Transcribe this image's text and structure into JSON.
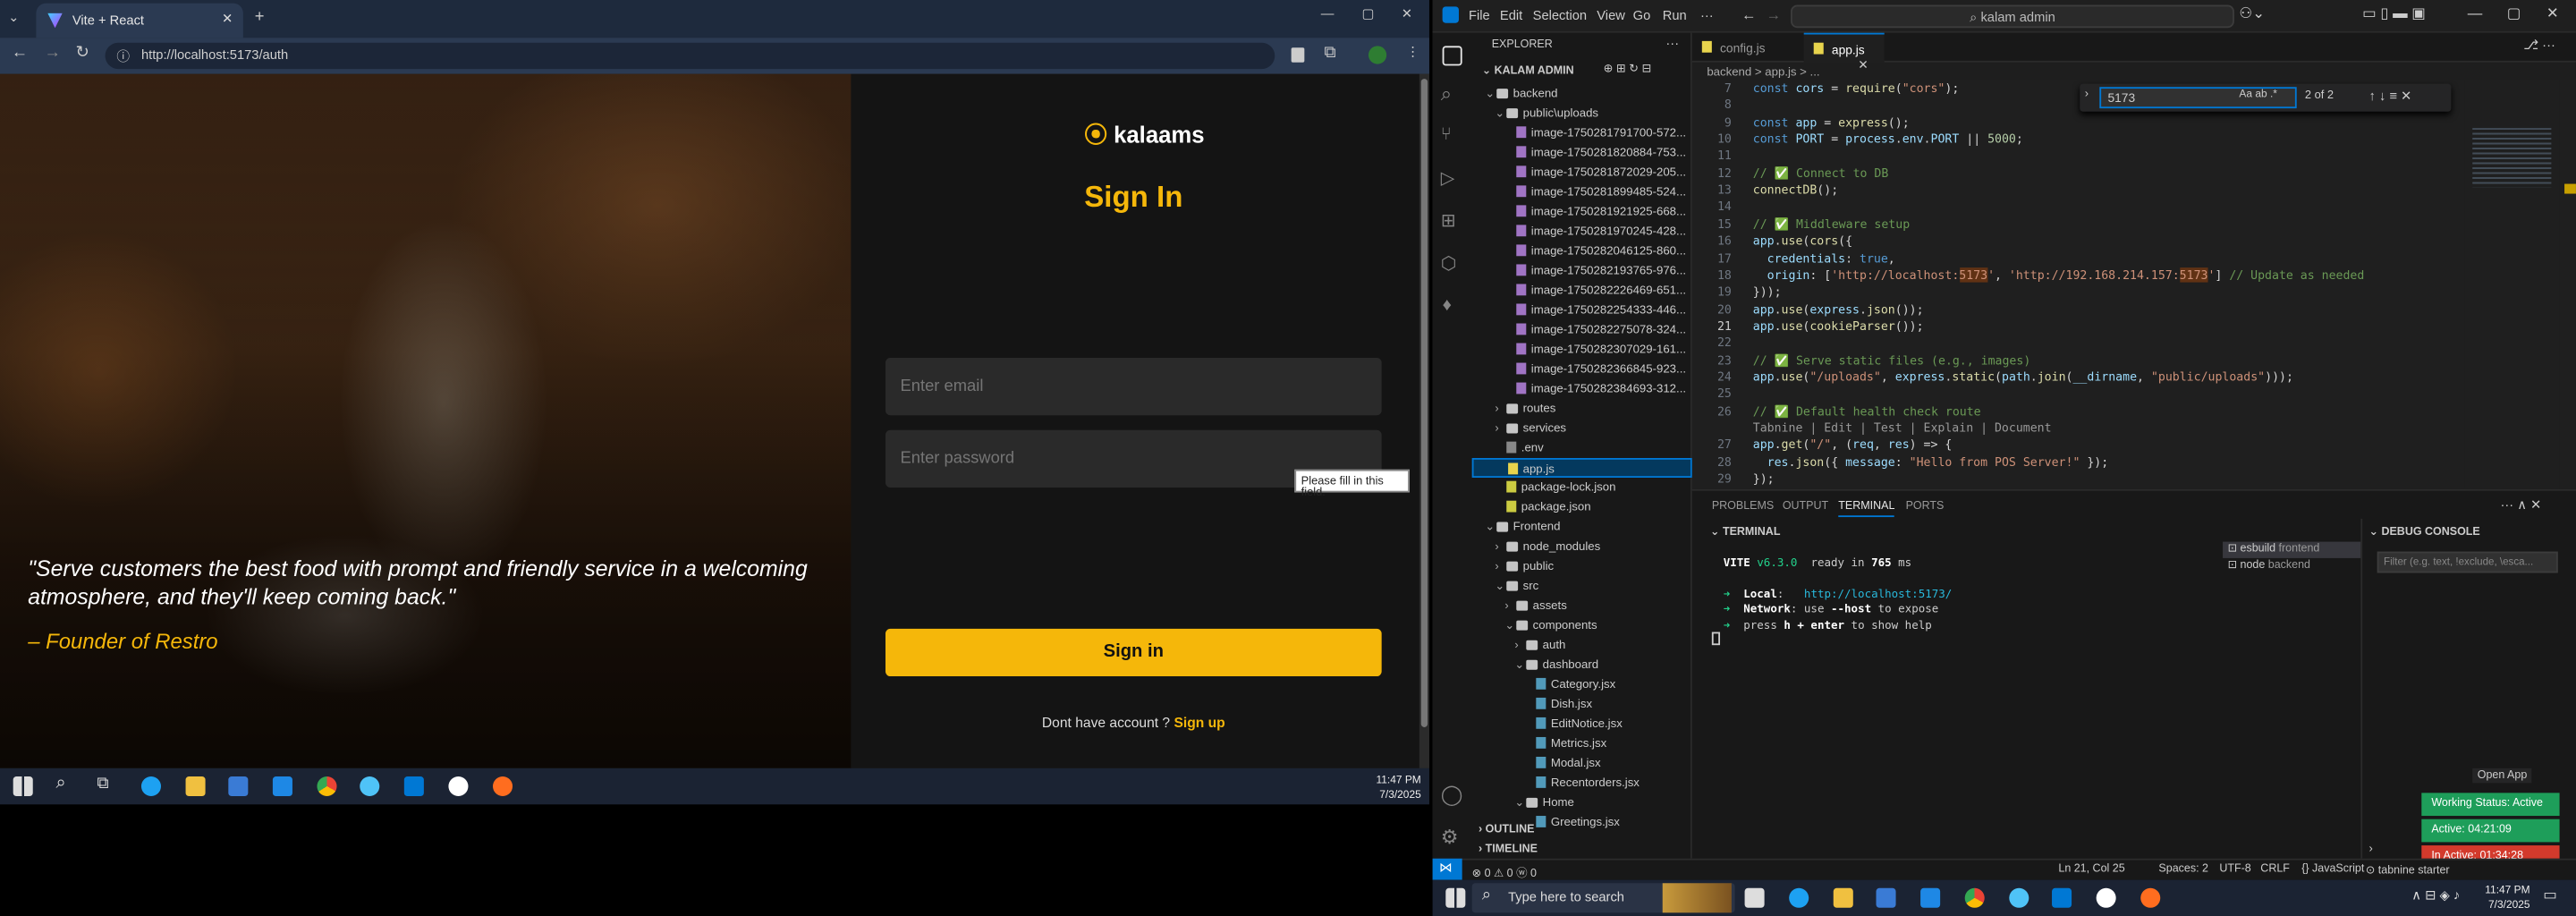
{
  "browser": {
    "tab_title": "Vite + React",
    "url": "http://localhost:5173/auth",
    "new_tab_label": "+",
    "page": {
      "logo": "kalaams",
      "title": "Sign In",
      "email_placeholder": "Enter email",
      "password_placeholder": "Enter password",
      "tooltip": "Please fill in this field.",
      "signin_button": "Sign in",
      "signup_prompt": "Dont have account ? ",
      "signup_link": "Sign up",
      "quote": "\"Serve customers the best food with prompt and friendly service in a welcoming atmosphere, and they'll keep coming back.\"",
      "quote_author": "– Founder of Restro"
    },
    "taskbar": {
      "time": "11:47 PM",
      "date": "7/3/2025"
    }
  },
  "vscode": {
    "menu": [
      "File",
      "Edit",
      "Selection",
      "View",
      "Go",
      "Run",
      "···"
    ],
    "search": "kalam admin",
    "explorer_title": "EXPLORER",
    "root": "KALAM ADMIN",
    "tree": [
      {
        "label": "backend",
        "kind": "folder-open",
        "depth": 1
      },
      {
        "label": "public\\uploads",
        "kind": "folder-open",
        "depth": 2
      },
      {
        "label": "image-1750281791700-572...",
        "kind": "image",
        "depth": 3
      },
      {
        "label": "image-1750281820884-753...",
        "kind": "image",
        "depth": 3
      },
      {
        "label": "image-1750281872029-205...",
        "kind": "image",
        "depth": 3
      },
      {
        "label": "image-1750281899485-524...",
        "kind": "image",
        "depth": 3
      },
      {
        "label": "image-1750281921925-668...",
        "kind": "image",
        "depth": 3
      },
      {
        "label": "image-1750281970245-428...",
        "kind": "image",
        "depth": 3
      },
      {
        "label": "image-1750282046125-860...",
        "kind": "image",
        "depth": 3
      },
      {
        "label": "image-1750282193765-976...",
        "kind": "image",
        "depth": 3
      },
      {
        "label": "image-1750282226469-651...",
        "kind": "image",
        "depth": 3
      },
      {
        "label": "image-1750282254333-446...",
        "kind": "image",
        "depth": 3
      },
      {
        "label": "image-1750282275078-324...",
        "kind": "image",
        "depth": 3
      },
      {
        "label": "image-1750282307029-161...",
        "kind": "image",
        "depth": 3
      },
      {
        "label": "image-1750282366845-923...",
        "kind": "image",
        "depth": 3
      },
      {
        "label": "image-1750282384693-312...",
        "kind": "image",
        "depth": 3
      },
      {
        "label": "routes",
        "kind": "folder",
        "depth": 2
      },
      {
        "label": "services",
        "kind": "folder",
        "depth": 2
      },
      {
        "label": ".env",
        "kind": "file",
        "depth": 2
      },
      {
        "label": "app.js",
        "kind": "js",
        "depth": 2,
        "selected": true
      },
      {
        "label": "package-lock.json",
        "kind": "json",
        "depth": 2
      },
      {
        "label": "package.json",
        "kind": "json",
        "depth": 2
      },
      {
        "label": "Frontend",
        "kind": "folder-open",
        "depth": 1
      },
      {
        "label": "node_modules",
        "kind": "folder",
        "depth": 2
      },
      {
        "label": "public",
        "kind": "folder",
        "depth": 2
      },
      {
        "label": "src",
        "kind": "folder-open",
        "depth": 2
      },
      {
        "label": "assets",
        "kind": "folder",
        "depth": 3
      },
      {
        "label": "components",
        "kind": "folder-open",
        "depth": 3
      },
      {
        "label": "auth",
        "kind": "folder",
        "depth": 4
      },
      {
        "label": "dashboard",
        "kind": "folder-open",
        "depth": 4
      },
      {
        "label": "Category.jsx",
        "kind": "jsx",
        "depth": 5
      },
      {
        "label": "Dish.jsx",
        "kind": "jsx",
        "depth": 5
      },
      {
        "label": "EditNotice.jsx",
        "kind": "jsx",
        "depth": 5
      },
      {
        "label": "Metrics.jsx",
        "kind": "jsx",
        "depth": 5
      },
      {
        "label": "Modal.jsx",
        "kind": "jsx",
        "depth": 5
      },
      {
        "label": "Recentorders.jsx",
        "kind": "jsx",
        "depth": 5
      },
      {
        "label": "Home",
        "kind": "folder-open",
        "depth": 4
      },
      {
        "label": "Greetings.jsx",
        "kind": "jsx",
        "depth": 5
      }
    ],
    "outline": "OUTLINE",
    "timeline": "TIMELINE",
    "tabs": [
      {
        "label": "config.js",
        "active": false
      },
      {
        "label": "app.js",
        "active": true
      }
    ],
    "breadcrumb": "backend  >  app.js  >  ...",
    "find": {
      "query": "5173",
      "count": "2 of 2"
    },
    "code_lines": [
      {
        "n": "7",
        "html": "<span class='kw'>const</span> <span class='var'>cors</span> = <span class='fn'>require</span>(<span class='str'>\"cors\"</span>);"
      },
      {
        "n": "8",
        "html": ""
      },
      {
        "n": "9",
        "html": "<span class='kw'>const</span> <span class='var'>app</span> = <span class='fn'>express</span>();"
      },
      {
        "n": "10",
        "html": "<span class='kw'>const</span> <span class='var'>PORT</span> = <span class='var'>process</span>.<span class='var'>env</span>.<span class='var'>PORT</span> || <span class='num'>5000</span>;"
      },
      {
        "n": "11",
        "html": ""
      },
      {
        "n": "12",
        "html": "<span class='cm'>// ✅ Connect to DB</span>"
      },
      {
        "n": "13",
        "html": "<span class='fn'>connectDB</span>();"
      },
      {
        "n": "14",
        "html": ""
      },
      {
        "n": "15",
        "html": "<span class='cm'>// ✅ Middleware setup</span>"
      },
      {
        "n": "16",
        "html": "<span class='var'>app</span>.<span class='fn'>use</span>(<span class='fn'>cors</span>({"
      },
      {
        "n": "17",
        "html": "  <span class='var'>credentials</span>: <span class='kw'>true</span>,"
      },
      {
        "n": "18",
        "html": "  <span class='var'>origin</span>: [<span class='str'>'http://localhost:<span class=\"hl\">5173</span>'</span>, <span class='str'>'http://192.168.214.157:<span class=\"hl\">5173</span>'</span>] <span class='cm'>// Update as needed</span>"
      },
      {
        "n": "19",
        "html": "}));"
      },
      {
        "n": "20",
        "html": "<span class='var'>app</span>.<span class='fn'>use</span>(<span class='var'>express</span>.<span class='fn'>json</span>());"
      },
      {
        "n": "21",
        "html": "<span class='var'>app</span>.<span class='fn'>use</span>(<span class='fn'>cookieParser</span>());"
      },
      {
        "n": "22",
        "html": ""
      },
      {
        "n": "23",
        "html": "<span class='cm'>// ✅ Serve static files (e.g., images)</span>"
      },
      {
        "n": "24",
        "html": "<span class='var'>app</span>.<span class='fn'>use</span>(<span class='str'>\"/uploads\"</span>, <span class='var'>express</span>.<span class='fn'>static</span>(<span class='var'>path</span>.<span class='fn'>join</span>(<span class='var'>__dirname</span>, <span class='str'>\"public/uploads\"</span>)));"
      },
      {
        "n": "25",
        "html": ""
      },
      {
        "n": "26",
        "html": "<span class='cm'>// ✅ Default health check route</span>"
      },
      {
        "n": "",
        "html": "<span style='color:#999'>Tabnine | Edit | Test | Explain | Document</span>"
      },
      {
        "n": "27",
        "html": "<span class='var'>app</span>.<span class='fn'>get</span>(<span class='str'>\"/\"</span>, (<span class='var'>req</span>, <span class='var'>res</span>) => {"
      },
      {
        "n": "28",
        "html": "  <span class='var'>res</span>.<span class='fn'>json</span>({ <span class='var'>message</span>: <span class='str'>\"Hello from POS Server!\"</span> });"
      },
      {
        "n": "29",
        "html": "});"
      }
    ],
    "panel_tabs": [
      "PROBLEMS",
      "OUTPUT",
      "TERMINAL",
      "PORTS"
    ],
    "terminal_title": "TERMINAL",
    "terminal_lines": [
      "<span class='green bold'>VITE</span> <span class='green'>v6.3.0</span>  ready in <span class='bold'>765</span> ms",
      "",
      "<span class='green'>➜</span>  <span class='bold'>Local</span>:   <span class='cyan'>http://localhost:5173/</span>",
      "<span class='green'>➜</span>  <span class='bold'>Network</span>: use <span class='bold'>--host</span> to expose",
      "<span class='green'>➜</span>  press <span class='bold'>h + enter</span> to show help"
    ],
    "terminal_sessions": [
      {
        "label": "esbuild",
        "sub": "frontend"
      },
      {
        "label": "node",
        "sub": "backend"
      }
    ],
    "debug_title": "DEBUG CONSOLE",
    "debug_filter": "Filter (e.g. text, !exclude, \\esca...",
    "open_app": "Open App",
    "work_status": "Working Status: Active",
    "active_time": "Active: 04:21:09",
    "inactive_time": "In Active: 01:34:28",
    "status": {
      "errors": "⊗ 0  ⚠ 0  ⓦ 0",
      "position": "Ln 21, Col 25",
      "spaces": "Spaces: 2",
      "encoding": "UTF-8",
      "eol": "CRLF",
      "lang": "{} JavaScript",
      "tabnine": "⊙ tabnine starter"
    },
    "taskbar": {
      "search": "Type here to search",
      "time": "11:47 PM",
      "date": "7/3/2025"
    },
    "colors": {
      "accent": "#0078d4",
      "brand_yellow": "#f5b70a",
      "active_green": "#1e9e5a",
      "inactive_red": "#d33a2c"
    }
  }
}
